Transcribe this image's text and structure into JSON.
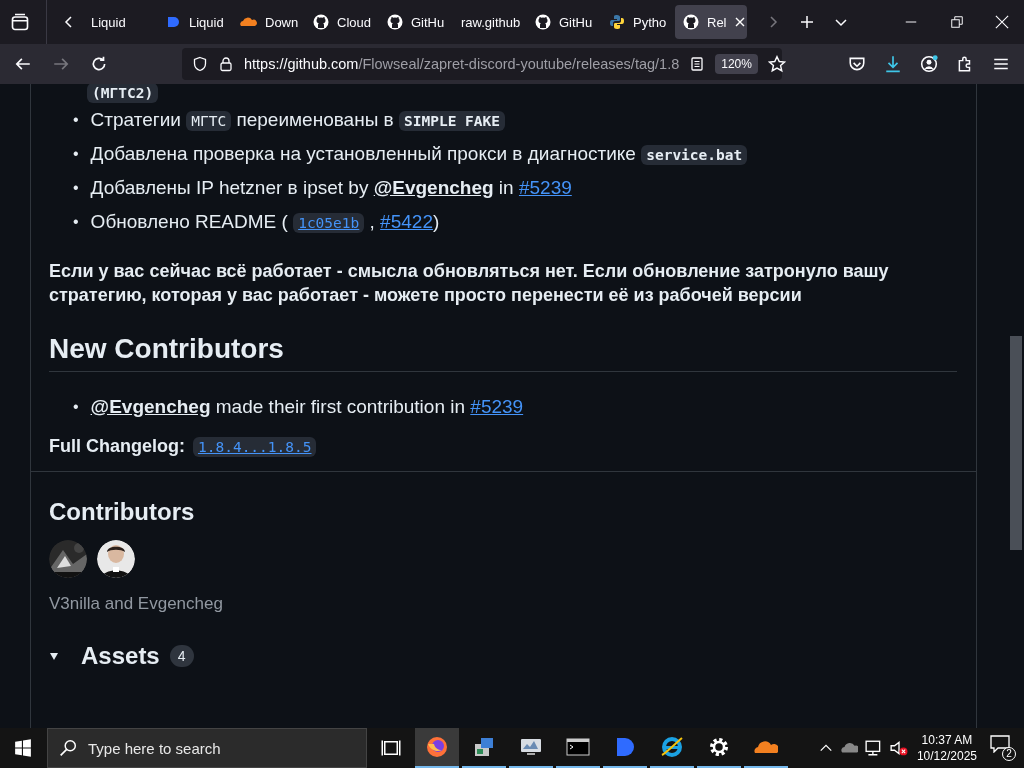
{
  "browser": {
    "tabs": [
      {
        "label": "Liquid",
        "kind": "plain",
        "selected": false
      },
      {
        "label": "Liquid",
        "kind": "drop",
        "selected": false
      },
      {
        "label": "Down",
        "kind": "cloud",
        "selected": false
      },
      {
        "label": "Cloud",
        "kind": "github",
        "selected": false
      },
      {
        "label": "GitHu",
        "kind": "github",
        "selected": false
      },
      {
        "label": "raw.github",
        "kind": "plain",
        "selected": false
      },
      {
        "label": "GitHu",
        "kind": "github",
        "selected": false
      },
      {
        "label": "Pytho",
        "kind": "python",
        "selected": false
      },
      {
        "label": "Rel",
        "kind": "github",
        "selected": true
      }
    ],
    "url_host": "https://github.com",
    "url_path": "/Flowseal/zapret-discord-youtube/releases/tag/1.8",
    "zoom": "120%"
  },
  "release": {
    "top_code": "(МГТС2)",
    "changes": [
      {
        "marker": "•",
        "parts": [
          {
            "kind": "text",
            "text": "Стратегии "
          },
          {
            "kind": "code",
            "text": "МГТС"
          },
          {
            "kind": "text",
            "text": " переименованы в "
          },
          {
            "kind": "code_bold",
            "text": "SIMPLE FAKE"
          }
        ]
      },
      {
        "marker": "•",
        "parts": [
          {
            "kind": "text",
            "text": "Добавлена проверка на установленный прокси в диагностике "
          },
          {
            "kind": "code_bold",
            "text": "service.bat"
          }
        ]
      },
      {
        "marker": "•",
        "parts": [
          {
            "kind": "text",
            "text": "Добавлены IP hetzner в ipset by "
          },
          {
            "kind": "user",
            "text": "@Evgencheg"
          },
          {
            "kind": "text",
            "text": " in "
          },
          {
            "kind": "link",
            "text": "#5239"
          }
        ]
      },
      {
        "marker": "•",
        "parts": [
          {
            "kind": "text",
            "text": "Обновлено README ( "
          },
          {
            "kind": "code_link",
            "text": "1c05e1b"
          },
          {
            "kind": "text",
            "text": " , "
          },
          {
            "kind": "link",
            "text": "#5422"
          },
          {
            "kind": "text",
            "text": ")"
          }
        ]
      }
    ],
    "note": "Если у вас сейчас всё работает - смысла обновляться нет. Если обновление затронуло вашу стратегию, которая у вас работает - можете просто перенести её из рабочей версии",
    "new_contributors_heading": "New Contributors",
    "new_contributors": [
      {
        "marker": "•",
        "parts": [
          {
            "kind": "user",
            "text": "@Evgencheg"
          },
          {
            "kind": "text",
            "text": " made their first contribution in "
          },
          {
            "kind": "link",
            "text": "#5239"
          }
        ]
      }
    ],
    "changelog_label": "Full Changelog:",
    "changelog_link": "1.8.4...1.8.5",
    "contributors_heading": "Contributors",
    "contributors_names": "V3nilla and Evgencheg",
    "assets_heading": "Assets",
    "assets_count": "4",
    "assets_expanded": true
  },
  "taskbar": {
    "search_placeholder": "Type here to search",
    "apps": [
      {
        "kind": "firefox",
        "selected": true,
        "running": true
      },
      {
        "kind": "installer",
        "selected": false,
        "running": true
      },
      {
        "kind": "monitor",
        "selected": false,
        "running": true
      },
      {
        "kind": "terminal",
        "selected": false,
        "running": true
      },
      {
        "kind": "drop",
        "selected": false,
        "running": true
      },
      {
        "kind": "ie",
        "selected": false,
        "running": true
      },
      {
        "kind": "gear",
        "selected": false,
        "running": true
      },
      {
        "kind": "cloud",
        "selected": false,
        "running": true
      }
    ],
    "time": "10:37 AM",
    "date": "10/12/2025",
    "notifications": "2"
  }
}
